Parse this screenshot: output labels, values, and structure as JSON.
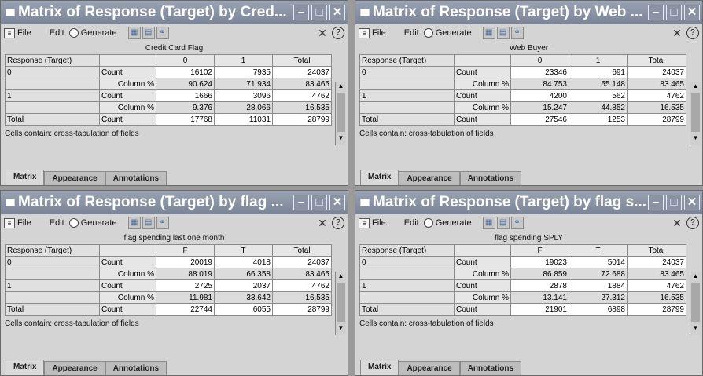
{
  "windows": [
    {
      "title": "Matrix of Response (Target) by Cred...",
      "menu": {
        "file": "File",
        "edit": "Edit",
        "generate": "Generate"
      },
      "col_field": "Credit Card Flag",
      "row_header": "Response (Target)",
      "col_headers": [
        "0",
        "1",
        "Total"
      ],
      "rows": [
        {
          "row": "0",
          "stat": "Count",
          "values": [
            "16102",
            "7935",
            "24037"
          ]
        },
        {
          "row": "",
          "stat": "Column %",
          "values": [
            "90.624",
            "71.934",
            "83.465"
          ]
        },
        {
          "row": "1",
          "stat": "Count",
          "values": [
            "1666",
            "3096",
            "4762"
          ]
        },
        {
          "row": "",
          "stat": "Column %",
          "values": [
            "9.376",
            "28.066",
            "16.535"
          ]
        },
        {
          "row": "Total",
          "stat": "Count",
          "values": [
            "17768",
            "11031",
            "28799"
          ]
        }
      ],
      "caption": "Cells contain: cross-tabulation of fields",
      "tabs": [
        "Matrix",
        "Appearance",
        "Annotations"
      ]
    },
    {
      "title": "Matrix of Response (Target) by Web ...",
      "menu": {
        "file": "File",
        "edit": "Edit",
        "generate": "Generate"
      },
      "col_field": "Web Buyer",
      "row_header": "Response (Target)",
      "col_headers": [
        "0",
        "1",
        "Total"
      ],
      "rows": [
        {
          "row": "0",
          "stat": "Count",
          "values": [
            "23346",
            "691",
            "24037"
          ]
        },
        {
          "row": "",
          "stat": "Column %",
          "values": [
            "84.753",
            "55.148",
            "83.465"
          ]
        },
        {
          "row": "1",
          "stat": "Count",
          "values": [
            "4200",
            "562",
            "4762"
          ]
        },
        {
          "row": "",
          "stat": "Column %",
          "values": [
            "15.247",
            "44.852",
            "16.535"
          ]
        },
        {
          "row": "Total",
          "stat": "Count",
          "values": [
            "27546",
            "1253",
            "28799"
          ]
        }
      ],
      "caption": "Cells contain: cross-tabulation of fields",
      "tabs": [
        "Matrix",
        "Appearance",
        "Annotations"
      ]
    },
    {
      "title": "Matrix of Response (Target) by flag ...",
      "menu": {
        "file": "File",
        "edit": "Edit",
        "generate": "Generate"
      },
      "col_field": "flag spending last one month",
      "row_header": "Response (Target)",
      "col_headers": [
        "F",
        "T",
        "Total"
      ],
      "rows": [
        {
          "row": "0",
          "stat": "Count",
          "values": [
            "20019",
            "4018",
            "24037"
          ]
        },
        {
          "row": "",
          "stat": "Column %",
          "values": [
            "88.019",
            "66.358",
            "83.465"
          ]
        },
        {
          "row": "1",
          "stat": "Count",
          "values": [
            "2725",
            "2037",
            "4762"
          ]
        },
        {
          "row": "",
          "stat": "Column %",
          "values": [
            "11.981",
            "33.642",
            "16.535"
          ]
        },
        {
          "row": "Total",
          "stat": "Count",
          "values": [
            "22744",
            "6055",
            "28799"
          ]
        }
      ],
      "caption": "Cells contain: cross-tabulation of fields",
      "tabs": [
        "Matrix",
        "Appearance",
        "Annotations"
      ]
    },
    {
      "title": "Matrix of Response (Target) by flag s...",
      "menu": {
        "file": "File",
        "edit": "Edit",
        "generate": "Generate"
      },
      "col_field": "flag spending SPLY",
      "row_header": "Response (Target)",
      "col_headers": [
        "F",
        "T",
        "Total"
      ],
      "rows": [
        {
          "row": "0",
          "stat": "Count",
          "values": [
            "19023",
            "5014",
            "24037"
          ]
        },
        {
          "row": "",
          "stat": "Column %",
          "values": [
            "86.859",
            "72.688",
            "83.465"
          ]
        },
        {
          "row": "1",
          "stat": "Count",
          "values": [
            "2878",
            "1884",
            "4762"
          ]
        },
        {
          "row": "",
          "stat": "Column %",
          "values": [
            "13.141",
            "27.312",
            "16.535"
          ]
        },
        {
          "row": "Total",
          "stat": "Count",
          "values": [
            "21901",
            "6898",
            "28799"
          ]
        }
      ],
      "caption": "Cells contain: cross-tabulation of fields",
      "tabs": [
        "Matrix",
        "Appearance",
        "Annotations"
      ]
    }
  ]
}
